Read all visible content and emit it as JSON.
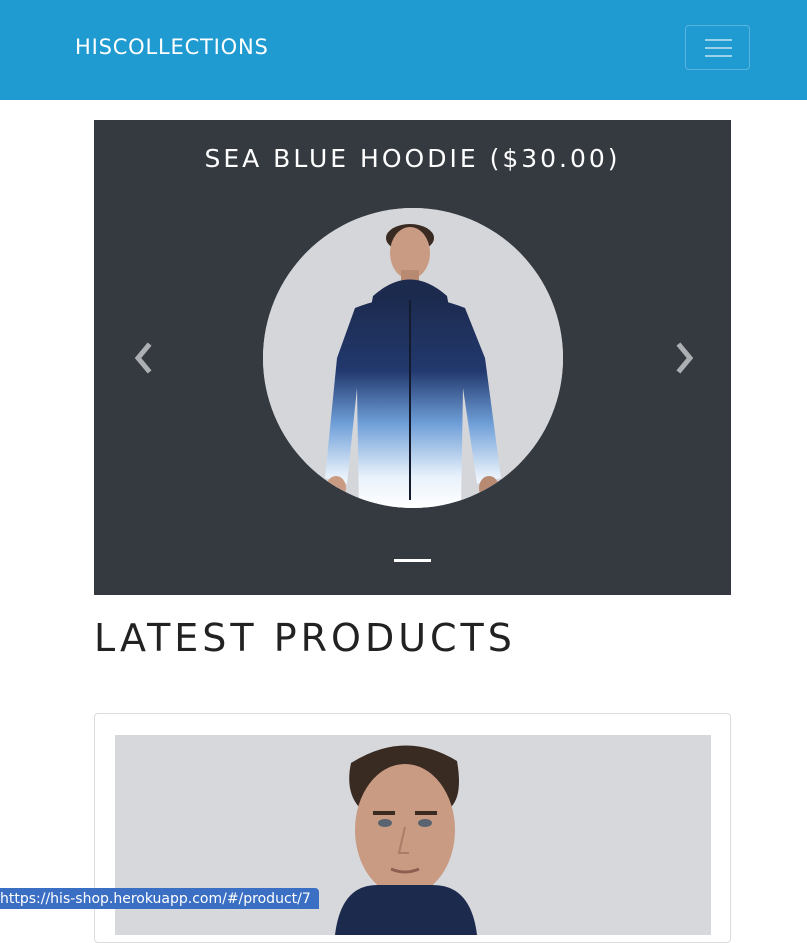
{
  "navbar": {
    "brand": "HISCOLLECTIONS",
    "toggler_icon": "hamburger-menu-icon",
    "background_color": "#1f9bd1"
  },
  "carousel": {
    "caption": "SEA BLUE HOODIE ($30.00)",
    "prev_icon": "chevron-left-icon",
    "next_icon": "chevron-right-icon",
    "background_color": "#343a40"
  },
  "main": {
    "section_title": "LATEST PRODUCTS"
  },
  "status_bar": {
    "url": "https://his-shop.herokuapp.com/#/product/7"
  }
}
